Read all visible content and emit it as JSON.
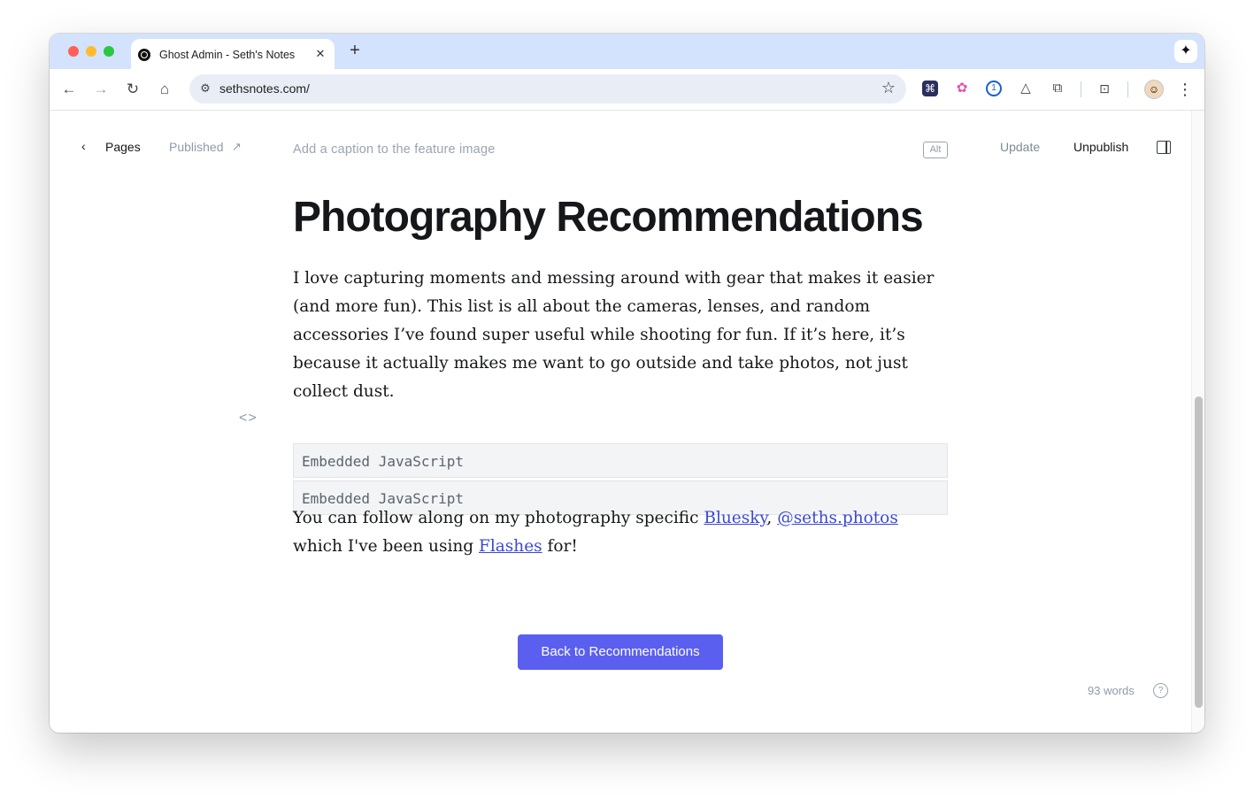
{
  "browser": {
    "tab_title": "Ghost Admin - Seth's Notes",
    "tab_close": "✕",
    "new_tab": "+",
    "url": "sethsnotes.com/",
    "colors": {
      "tabstrip": "#d3e3fd",
      "omnibox": "#e9eef6"
    }
  },
  "toolbar": {
    "back_icon": "←",
    "forward_icon": "→",
    "reload_icon": "↻",
    "home_icon": "⌂",
    "site_info_icon": "⚙",
    "star_icon": "☆",
    "extensions": [
      "raycast-icon",
      "flower-icon",
      "password-icon",
      "triangle-icon",
      "puzzle-icon"
    ],
    "kebab": "⋮"
  },
  "editor": {
    "back_label": "‹",
    "breadcrumb": "Pages",
    "status": "Published",
    "status_arrow": "↗",
    "caption_placeholder": "Add a caption to the feature image",
    "alt_label": "Alt",
    "update_label": "Update",
    "unpublish_label": "Unpublish",
    "word_count": "93 words",
    "help_icon": "?"
  },
  "content": {
    "title": "Photography Recommendations",
    "intro": "I love capturing moments and messing around with gear that makes it easier (and more fun). This list is all about the cameras, lenses, and random accessories I’ve found super useful while shooting for fun. If it’s here, it’s because it actually makes me want to go outside and take photos, not just collect dust.",
    "code_icon": "<>",
    "code_blocks": [
      "Embedded JavaScript",
      "Embedded JavaScript"
    ],
    "follow_prefix": "You can follow along on my photography specific ",
    "follow_link1": "Bluesky",
    "follow_comma": ", ",
    "follow_link2": "@seths.photos",
    "follow_middle": " which I've been using ",
    "follow_link3": "Flashes",
    "follow_suffix": " for!",
    "cta_label": "Back to Recommendations",
    "colors": {
      "cta": "#5a5fef",
      "link": "#3b48d4"
    }
  }
}
